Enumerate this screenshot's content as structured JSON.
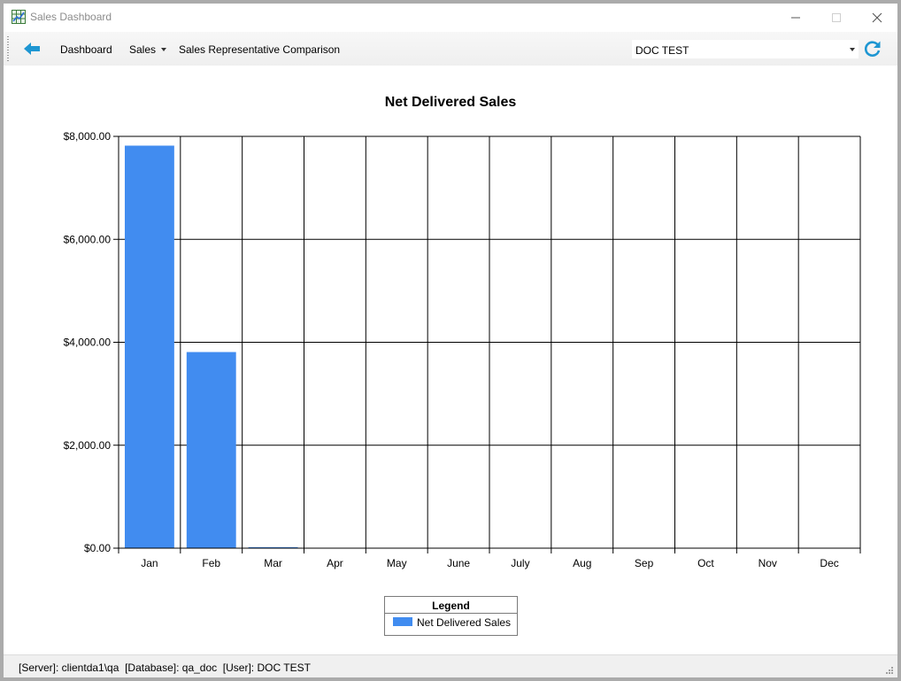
{
  "window": {
    "title": "Sales Dashboard"
  },
  "toolbar": {
    "items": [
      "Dashboard",
      "Sales",
      "Sales Representative Comparison"
    ],
    "combo_value": "DOC TEST"
  },
  "chart_data": {
    "type": "bar",
    "title": "Net Delivered Sales",
    "xlabel": "",
    "ylabel": "",
    "categories": [
      "Jan",
      "Feb",
      "Mar",
      "Apr",
      "May",
      "June",
      "July",
      "Aug",
      "Sep",
      "Oct",
      "Nov",
      "Dec"
    ],
    "series": [
      {
        "name": "Net Delivered Sales",
        "color": "#418cf0",
        "values": [
          7820,
          3810,
          20,
          0,
          0,
          0,
          0,
          0,
          0,
          0,
          0,
          0
        ]
      }
    ],
    "ylim": [
      0,
      8000
    ],
    "yticks": [
      0,
      2000,
      4000,
      6000,
      8000
    ],
    "ytick_labels": [
      "$0.00",
      "$2,000.00",
      "$4,000.00",
      "$6,000.00",
      "$8,000.00"
    ],
    "grid": true,
    "legend": {
      "title": "Legend",
      "placement": "bottom-center"
    }
  },
  "statusbar": {
    "text": "[Server]: clientda1\\qa  [Database]: qa_doc  [User]: DOC TEST"
  },
  "colors": {
    "accent": "#1e96d2",
    "bar": "#418cf0"
  },
  "icons": [
    "app-chart-icon",
    "back-arrow-icon",
    "dropdown-caret-icon",
    "refresh-icon",
    "minimize-icon",
    "maximize-icon",
    "close-icon"
  ]
}
